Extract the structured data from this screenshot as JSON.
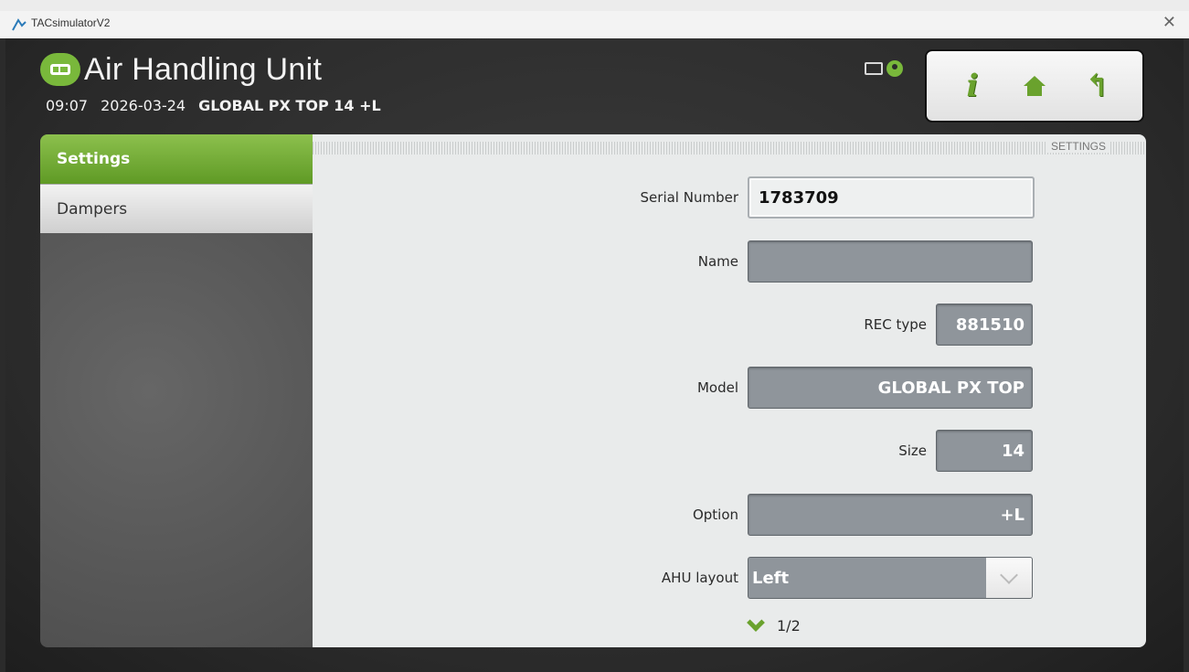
{
  "window": {
    "title": "TACsimulatorV2",
    "close_label": "✕"
  },
  "header": {
    "title": "Air Handling Unit",
    "time": "09:07",
    "date": "2026-03-24",
    "device": "GLOBAL PX TOP 14 +L"
  },
  "nav": {
    "info_glyph": "i",
    "return_glyph": "↰"
  },
  "sidebar": {
    "items": [
      {
        "label": "Settings"
      },
      {
        "label": "Dampers"
      }
    ]
  },
  "panel": {
    "header_label": "SETTINGS",
    "fields": {
      "serial_number": {
        "label": "Serial Number",
        "value": "1783709"
      },
      "name": {
        "label": "Name",
        "value": ""
      },
      "rec_type": {
        "label": "REC type",
        "value": "881510"
      },
      "model": {
        "label": "Model",
        "value": "GLOBAL PX TOP"
      },
      "size": {
        "label": "Size",
        "value": "14"
      },
      "option": {
        "label": "Option",
        "value": "+L"
      },
      "ahu_layout": {
        "label": "AHU layout",
        "value": "Left"
      }
    },
    "pager": "1/2"
  },
  "colors": {
    "accent_green": "#79b83b",
    "field_grey": "#8f959b",
    "panel_bg": "#e9ebeb"
  }
}
